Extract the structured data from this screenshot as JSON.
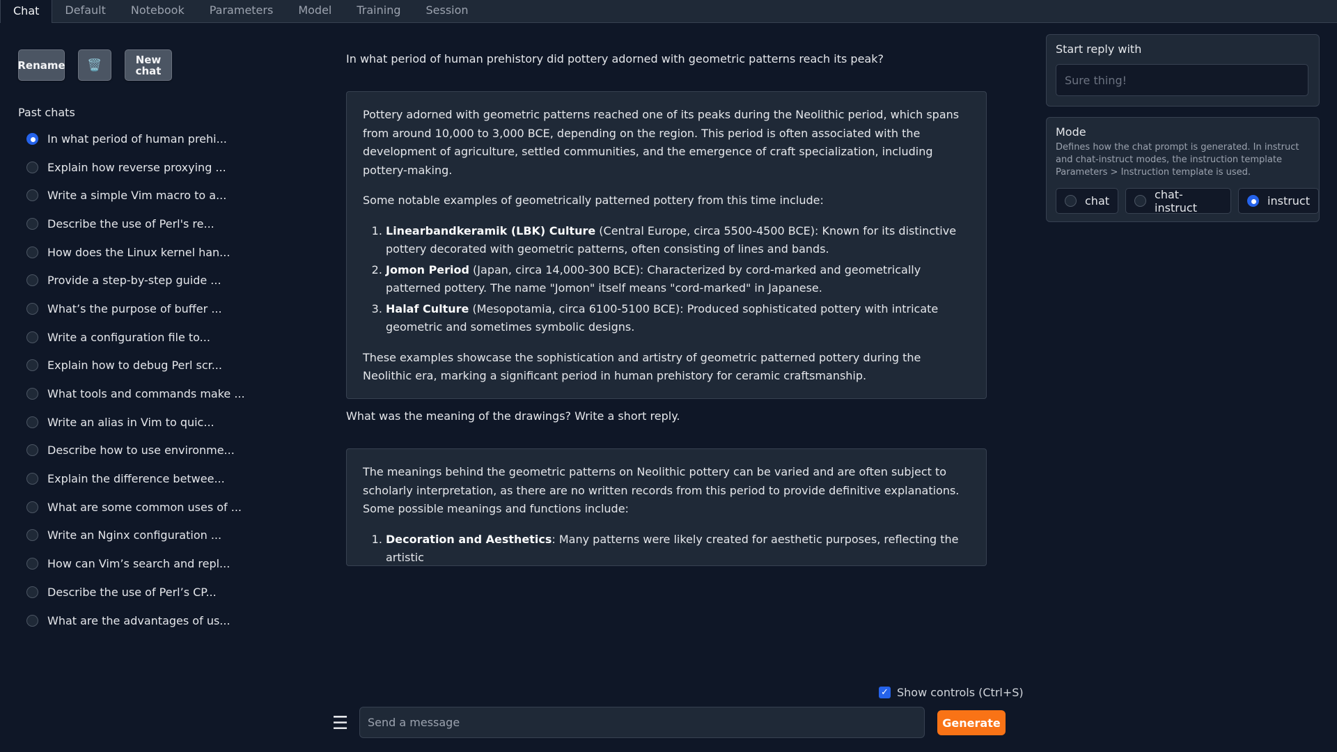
{
  "tabs": [
    "Chat",
    "Default",
    "Notebook",
    "Parameters",
    "Model",
    "Training",
    "Session"
  ],
  "sidebar": {
    "rename_label": "Rename",
    "trash_icon": "🗑️",
    "new_chat_line1": "New",
    "new_chat_line2": "chat",
    "past_chats_label": "Past chats",
    "chats": [
      "In what period of human prehi...",
      "Explain how reverse proxying ...",
      "Write a simple Vim macro to a...",
      "Describe the use of Perl's re...",
      "How does the Linux kernel han...",
      "Provide a step-by-step guide ...",
      "What’s the purpose of buffer ...",
      "Write a configuration file to...",
      "Explain how to debug Perl scr...",
      "What tools and commands make ...",
      "Write an alias in Vim to quic...",
      "Describe how to use environme...",
      "Explain the difference betwee...",
      "What are some common uses of ...",
      "Write an Nginx configuration ...",
      "How can Vim’s search and repl...",
      "Describe the use of Perl’s CP...",
      "What are the advantages of us..."
    ]
  },
  "conversation": {
    "q1": "In what period of human prehistory did pottery adorned with geometric patterns reach its peak?",
    "a1": {
      "p1": "Pottery adorned with geometric patterns reached one of its peaks during the Neolithic period, which spans from around 10,000 to 3,000 BCE, depending on the region. This period is often associated with the development of agriculture, settled communities, and the emergence of craft specialization, including pottery-making.",
      "p2": "Some notable examples of geometrically patterned pottery from this time include:",
      "items": [
        {
          "bold": "Linearbandkeramik (LBK) Culture",
          "text": " (Central Europe, circa 5500-4500 BCE): Known for its distinctive pottery decorated with geometric patterns, often consisting of lines and bands."
        },
        {
          "bold": "Jomon Period",
          "text": " (Japan, circa 14,000-300 BCE): Characterized by cord-marked and geometrically patterned pottery. The name \"Jomon\" itself means \"cord-marked\" in Japanese."
        },
        {
          "bold": "Halaf Culture",
          "text": " (Mesopotamia, circa 6100-5100 BCE): Produced sophisticated pottery with intricate geometric and sometimes symbolic designs."
        }
      ],
      "p3": "These examples showcase the sophistication and artistry of geometric patterned pottery during the Neolithic era, marking a significant period in human prehistory for ceramic craftsmanship."
    },
    "q2": "What was the meaning of the drawings? Write a short reply.",
    "a2": {
      "p1": "The meanings behind the geometric patterns on Neolithic pottery can be varied and are often subject to scholarly interpretation, as there are no written records from this period to provide definitive explanations. Some possible meanings and functions include:",
      "items": [
        {
          "bold": "Decoration and Aesthetics",
          "text": ": Many patterns were likely created for aesthetic purposes, reflecting the artistic"
        }
      ]
    }
  },
  "input": {
    "show_controls_label": "Show controls (Ctrl+S)",
    "placeholder": "Send a message",
    "generate_label": "Generate"
  },
  "right_panel": {
    "start_reply_label": "Start reply with",
    "start_reply_placeholder": "Sure thing!",
    "mode_label": "Mode",
    "mode_description": "Defines how the chat prompt is generated. In instruct and chat-instruct modes, the instruction template Parameters > Instruction template is used.",
    "modes": [
      "chat",
      "chat-instruct",
      "instruct"
    ],
    "selected_mode": "instruct"
  },
  "colors": {
    "background": "#0f1727",
    "panel": "#1f2937",
    "accent": "#f97316",
    "radio_selected": "#2563eb"
  }
}
